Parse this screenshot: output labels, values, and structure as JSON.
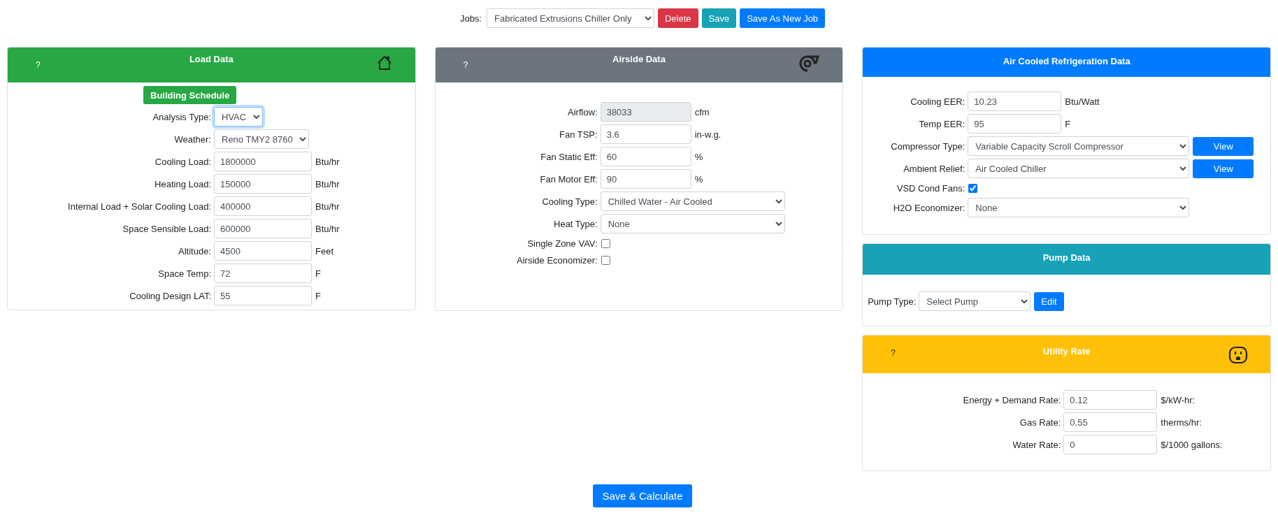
{
  "jobs_bar": {
    "label": "Jobs:",
    "value": "Fabricated Extrusions Chiller Only",
    "buttons": [
      {
        "label": "Delete",
        "kind": "delete"
      },
      {
        "label": "Save",
        "kind": "save"
      },
      {
        "label": "Save As New Job",
        "kind": "save_new"
      }
    ]
  },
  "columns": [
    {
      "panels": [
        {
          "title": "Load Data",
          "kind": "load",
          "help": "?",
          "rows": [
            {
              "kind": "button",
              "label": "Building Schedule"
            },
            {
              "kind": "select",
              "label": "Analysis Type:",
              "value": "HVAC",
              "focused": true
            },
            {
              "kind": "select",
              "label": "Weather:",
              "value": "Reno TMY2 8760",
              "focused": false
            },
            {
              "kind": "input",
              "label": "Cooling Load:",
              "value": "1800000",
              "unit": "Btu/hr",
              "readonly": false
            },
            {
              "kind": "input",
              "label": "Heating Load:",
              "value": "150000",
              "unit": "Btu/hr",
              "readonly": false
            },
            {
              "kind": "input",
              "label": "Internal Load + Solar Cooling Load:",
              "value": "400000",
              "unit": "Btu/hr",
              "readonly": false
            },
            {
              "kind": "input",
              "label": "Space Sensible Load:",
              "value": "600000",
              "unit": "Btu/hr",
              "readonly": false
            },
            {
              "kind": "input",
              "label": "Altitude:",
              "value": "4500",
              "unit": "Feet",
              "readonly": false
            },
            {
              "kind": "input",
              "label": "Space Temp:",
              "value": "72",
              "unit": "F",
              "readonly": false
            },
            {
              "kind": "input",
              "label": "Cooling Design LAT:",
              "value": "55",
              "unit": "F",
              "readonly": false
            }
          ]
        }
      ]
    },
    {
      "panels": [
        {
          "title": "Airside Data",
          "kind": "airside",
          "help": "?",
          "rows": [
            {
              "kind": "input",
              "label": "Airflow:",
              "value": "38033",
              "unit": "cfm",
              "readonly": true
            },
            {
              "kind": "input",
              "label": "Fan TSP:",
              "value": "3.6",
              "unit": "in-w.g.",
              "readonly": false
            },
            {
              "kind": "input",
              "label": "Fan Static Eff:",
              "value": "60",
              "unit": "%",
              "readonly": false
            },
            {
              "kind": "input",
              "label": "Fan Motor Eff:",
              "value": "90",
              "unit": "%",
              "readonly": false
            },
            {
              "kind": "select",
              "label": "Cooling Type:",
              "value": "Chilled Water - Air Cooled",
              "focused": false
            },
            {
              "kind": "select",
              "label": "Heat Type:",
              "value": "None",
              "focused": false
            },
            {
              "kind": "checkbox",
              "label": "Single Zone VAV:",
              "checked": false
            },
            {
              "kind": "checkbox",
              "label": "Airside Economizer:",
              "checked": false
            }
          ]
        }
      ]
    },
    {
      "panels": [
        {
          "title": "Air Cooled Refrigeration Data",
          "kind": "refrigeration",
          "rows": [
            {
              "kind": "input",
              "label": "Cooling EER:",
              "value": "10.23",
              "unit": "Btu/Watt",
              "readonly": false
            },
            {
              "kind": "input",
              "label": "Temp EER:",
              "value": "95",
              "unit": "F",
              "readonly": false
            },
            {
              "kind": "select",
              "label": "Compressor Type:",
              "value": "Variable Capacity Scroll Compressor",
              "focused": false,
              "button": "View"
            },
            {
              "kind": "select",
              "label": "Ambient Relief:",
              "value": "Air Cooled Chiller",
              "focused": false,
              "button": "View"
            },
            {
              "kind": "checkbox",
              "label": "VSD Cond Fans:",
              "checked": true
            },
            {
              "kind": "select",
              "label": "H2O Economizer:",
              "value": "None",
              "focused": false
            }
          ]
        },
        {
          "title": "Pump Data",
          "kind": "pump",
          "rows": [
            {
              "kind": "select",
              "label": "Pump Type:",
              "value": "Select Pump",
              "focused": false,
              "button": "Edit"
            }
          ]
        },
        {
          "title": "Utility Rate",
          "kind": "utility",
          "help": "?",
          "rows": [
            {
              "kind": "input",
              "label": "Energy + Demand Rate:",
              "value": "0.12",
              "unit": "$/kW-hr:",
              "readonly": false
            },
            {
              "kind": "input",
              "label": "Gas Rate:",
              "value": "0.55",
              "unit": "therms/hr:",
              "readonly": false
            },
            {
              "kind": "input",
              "label": "Water Rate:",
              "value": "0",
              "unit": "$/1000 gallons:",
              "readonly": false
            }
          ]
        }
      ]
    }
  ],
  "submit": {
    "label": "Save & Calculate"
  }
}
